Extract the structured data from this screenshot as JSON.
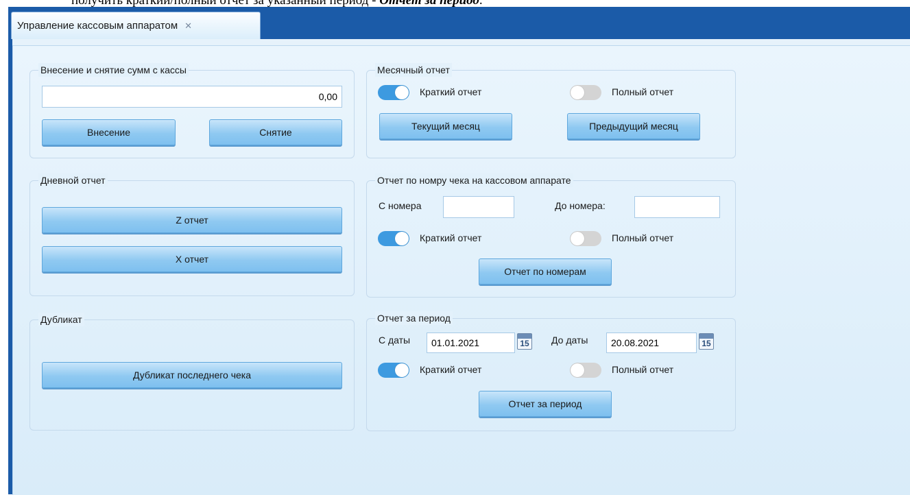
{
  "document_fragment": {
    "text_plain": "получить краткий/полный отчет за указанный период - ",
    "text_emphasis": "Отчет за период",
    "suffix": "."
  },
  "tab": {
    "title": "Управление кассовым аппаратом",
    "close_glyph": "✕"
  },
  "cash": {
    "title": "Внесение и снятие сумм с кассы",
    "amount": "0,00",
    "deposit_label": "Внесение",
    "withdraw_label": "Снятие"
  },
  "daily": {
    "title": "Дневной отчет",
    "z_label": "Z отчет",
    "x_label": "X отчет"
  },
  "duplicate": {
    "title": "Дубликат",
    "button_label": "Дубликат последнего чека"
  },
  "monthly": {
    "title": "Месячный отчет",
    "short_label": "Краткий отчет",
    "short_on": true,
    "full_label": "Полный отчет",
    "full_on": false,
    "current_label": "Текущий месяц",
    "previous_label": "Предыдущий месяц"
  },
  "by_number": {
    "title": "Отчет по номру чека на кассовом аппарате",
    "from_label": "С номера",
    "from_value": "",
    "to_label": "До номера:",
    "to_value": "",
    "short_label": "Краткий отчет",
    "short_on": true,
    "full_label": "Полный отчет",
    "full_on": false,
    "button_label": "Отчет по номерам"
  },
  "period": {
    "title": "Отчет за период",
    "from_label": "С даты",
    "from_value": "01.01.2021",
    "to_label": "До даты",
    "to_value": "20.08.2021",
    "calendar_day": "15",
    "short_label": "Краткий отчет",
    "short_on": true,
    "full_label": "Полный отчет",
    "full_on": false,
    "button_label": "Отчет за период"
  },
  "colors": {
    "accent": "#1b5ba8",
    "toggle_on": "#3d9ae0",
    "toggle_off": "#d4d4d4",
    "button": "#8fc9f1"
  }
}
